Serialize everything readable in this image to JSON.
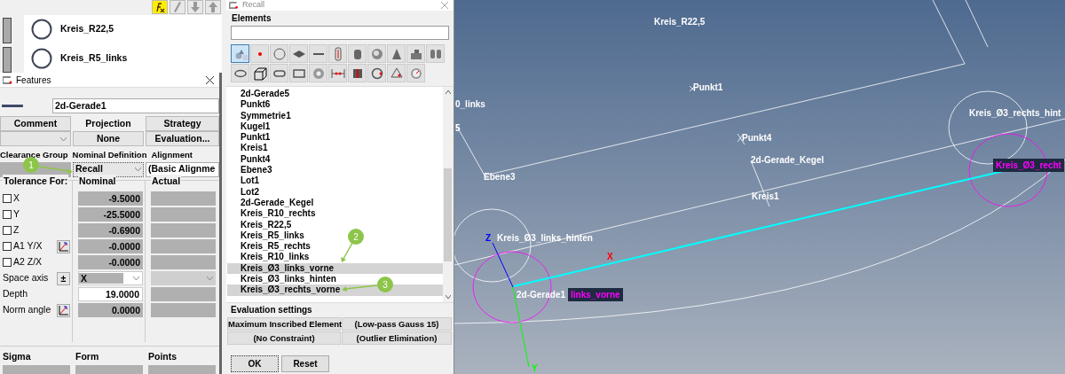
{
  "feature_list": [
    {
      "name": "Kreis_R22,5"
    },
    {
      "name": "Kreis_R5_links"
    }
  ],
  "features": {
    "title": "Features",
    "name_value": "2d-Gerade1",
    "tabs": [
      {
        "label": "Comment",
        "selected": false
      },
      {
        "label": "Projection",
        "selected": true
      },
      {
        "label": "Strategy",
        "selected": false
      }
    ],
    "projection": "None",
    "evaluation": "Evaluation...",
    "headers": [
      "Clearance Group",
      "Nominal Definition",
      "Alignment"
    ],
    "nominal_definition": "Recall",
    "alignment": "(Basic Alignme",
    "columns": [
      "Tolerance For:",
      "Nominal",
      "Actual"
    ],
    "rows": [
      {
        "kind": "checkbox",
        "label": "X",
        "checked": false,
        "nominal": "-9.5000"
      },
      {
        "kind": "checkbox",
        "label": "Y",
        "checked": false,
        "nominal": "-25.5000"
      },
      {
        "kind": "checkbox",
        "label": "Z",
        "checked": false,
        "nominal": "-0.6900"
      },
      {
        "kind": "checkbox-icon",
        "label": "A1 Y/X",
        "checked": false,
        "nominal": "-0.0000"
      },
      {
        "kind": "checkbox",
        "label": "A2 Z/X",
        "checked": false,
        "nominal": "-0.0000"
      },
      {
        "kind": "select",
        "label": "Space axis",
        "button": "±",
        "nominal": "X"
      },
      {
        "kind": "input",
        "label": "Depth",
        "nominal": "19.0000"
      },
      {
        "kind": "icon",
        "label": "Norm angle",
        "nominal": "0.0000"
      }
    ],
    "results": [
      "Sigma",
      "Form",
      "Points"
    ]
  },
  "recall": {
    "title": "Recall",
    "group_label": "Elements",
    "element_types": [
      {
        "kind": "shapes",
        "selected": true
      },
      {
        "kind": "point",
        "selected": false
      },
      {
        "kind": "circle",
        "selected": false
      },
      {
        "kind": "plane",
        "selected": false
      },
      {
        "kind": "line",
        "selected": false
      },
      {
        "kind": "gauge",
        "selected": false
      },
      {
        "kind": "cylinder",
        "selected": false
      },
      {
        "kind": "sphere",
        "selected": false
      },
      {
        "kind": "cone",
        "selected": false
      },
      {
        "kind": "stud",
        "selected": false
      },
      {
        "kind": "pair",
        "selected": false
      },
      {
        "kind": "ellipse",
        "selected": false
      },
      {
        "kind": "box",
        "selected": false
      },
      {
        "kind": "slot",
        "selected": false
      },
      {
        "kind": "rectangle",
        "selected": false
      },
      {
        "kind": "torus",
        "selected": false
      },
      {
        "kind": "distance",
        "selected": false
      },
      {
        "kind": "profile",
        "selected": false
      },
      {
        "kind": "circle-point",
        "selected": false
      },
      {
        "kind": "angle",
        "selected": false
      },
      {
        "kind": "dial",
        "selected": false
      }
    ],
    "items": [
      {
        "label": "2d-Gerade5",
        "selected": false
      },
      {
        "label": "Punkt6",
        "selected": false
      },
      {
        "label": "Symmetrie1",
        "selected": false
      },
      {
        "label": "Kugel1",
        "selected": false
      },
      {
        "label": "Punkt1",
        "selected": false
      },
      {
        "label": "Kreis1",
        "selected": false
      },
      {
        "label": "Punkt4",
        "selected": false
      },
      {
        "label": "Ebene3",
        "selected": false
      },
      {
        "label": "Lot1",
        "selected": false
      },
      {
        "label": "Lot2",
        "selected": false
      },
      {
        "label": "2d-Gerade_Kegel",
        "selected": false
      },
      {
        "label": "Kreis_R10_rechts",
        "selected": false
      },
      {
        "label": "Kreis_R22,5",
        "selected": false
      },
      {
        "label": "Kreis_R5_links",
        "selected": false
      },
      {
        "label": "Kreis_R5_rechts",
        "selected": false
      },
      {
        "label": "Kreis_R10_links",
        "selected": false
      },
      {
        "label": "Kreis_Ø3_links_vorne",
        "selected": true
      },
      {
        "label": "Kreis_Ø3_links_hinten",
        "selected": false
      },
      {
        "label": "Kreis_Ø3_rechts_vorne",
        "selected": true
      }
    ],
    "settings_label": "Evaluation settings",
    "settings": [
      "Maximum Inscribed Element",
      "(Low-pass Gauss 15)",
      "(No Constraint)",
      "(Outlier Elimination)"
    ],
    "buttons": [
      "OK",
      "Reset"
    ]
  },
  "canvas_labels": [
    {
      "text": "Kreis_R22,5",
      "color": "#ffffff"
    },
    {
      "text": "Punkt1",
      "color": "#ffffff"
    },
    {
      "text": "0_links",
      "color": "#ffffff"
    },
    {
      "text": "5",
      "color": "#ffffff"
    },
    {
      "text": "Ebene3",
      "color": "#ffffff"
    },
    {
      "text": "Punkt4",
      "color": "#ffffff"
    },
    {
      "text": "2d-Gerade_Kegel",
      "color": "#ffffff"
    },
    {
      "text": "Kreis1",
      "color": "#ffffff"
    },
    {
      "text": "Kreis_Ø3_links_hinten",
      "color": "#ffffff"
    },
    {
      "text": "2d-Gerade1",
      "color": "#ffffff"
    },
    {
      "text": "links_vorne",
      "color": "#ff00ff"
    },
    {
      "text": "Kreis_Ø3_rechts_hint",
      "color": "#ffffff"
    },
    {
      "text": "Kreis_Ø3_recht",
      "color": "#ff00ff"
    },
    {
      "text": "Z",
      "color": "#0000ff"
    },
    {
      "text": "X",
      "color": "#ff0000"
    },
    {
      "text": "Y",
      "color": "#00ff00"
    }
  ],
  "callouts": [
    {
      "number": "1"
    },
    {
      "number": "2"
    },
    {
      "number": "3"
    }
  ]
}
